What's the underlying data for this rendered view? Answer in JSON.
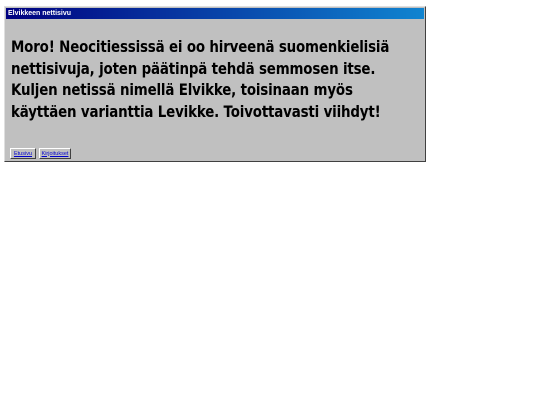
{
  "window": {
    "title": "Elvikkeen nettisivu"
  },
  "content": {
    "text": "Moro! Neocitiessissä ei oo hirveenä suomenkielisiä nettisivuja, joten päätinpä tehdä semmosen itse. Kuljen netissä nimellä Elvikke, toisinaan myös käyttäen varianttia Levikke. Toivottavasti viihdyt!"
  },
  "buttons": {
    "etusivu": "Etusivu",
    "kirjoitukset": "Kirjoitukset"
  },
  "colors": {
    "titlebar_start": "#000080",
    "titlebar_end": "#1084d0",
    "window_bg": "#c0c0c0",
    "link": "#0000cc"
  }
}
